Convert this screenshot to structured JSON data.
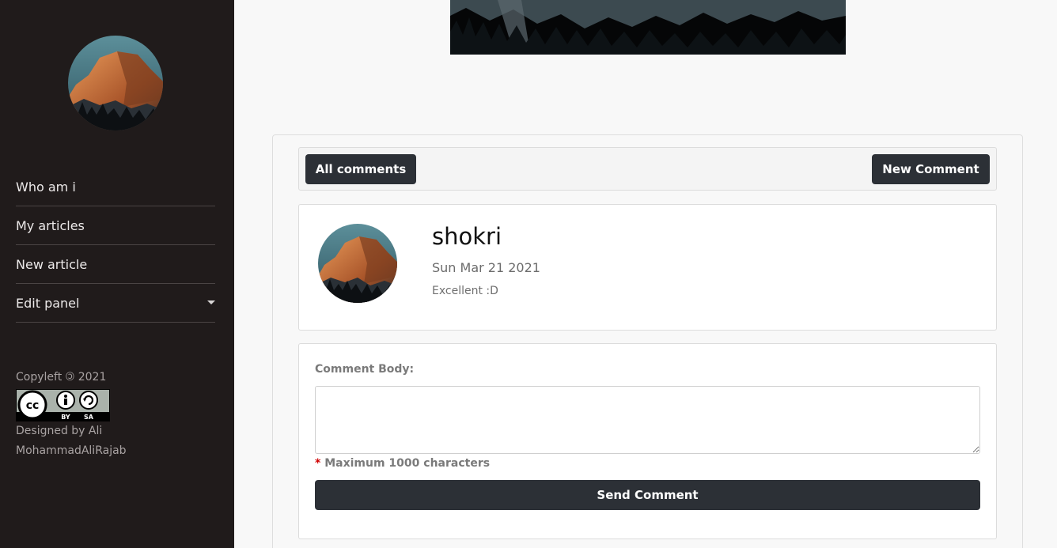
{
  "sidebar": {
    "nav": [
      {
        "label": "Who am i"
      },
      {
        "label": "My articles"
      },
      {
        "label": "New article"
      },
      {
        "label": "Edit panel"
      }
    ],
    "copyleft": "Copyleft 🄯 2021",
    "license": {
      "main": "cc",
      "sub_by": "BY",
      "sub_sa": "SA"
    },
    "designed_line1": "Designed by Ali",
    "designed_line2": "MohammadAliRajab"
  },
  "comments": {
    "all_label": "All comments",
    "new_label": "New Comment",
    "items": [
      {
        "author": "shokri",
        "date": "Sun Mar 21 2021",
        "text": "Excellent :D"
      }
    ]
  },
  "form": {
    "label": "Comment Body:",
    "value": "",
    "hint_star": "*",
    "hint": "Maximum 1000 characters",
    "submit_label": "Send Comment"
  },
  "colors": {
    "sidebar_bg": "#201b1b",
    "button_dark": "#2c3036",
    "required_star": "#d00000"
  }
}
